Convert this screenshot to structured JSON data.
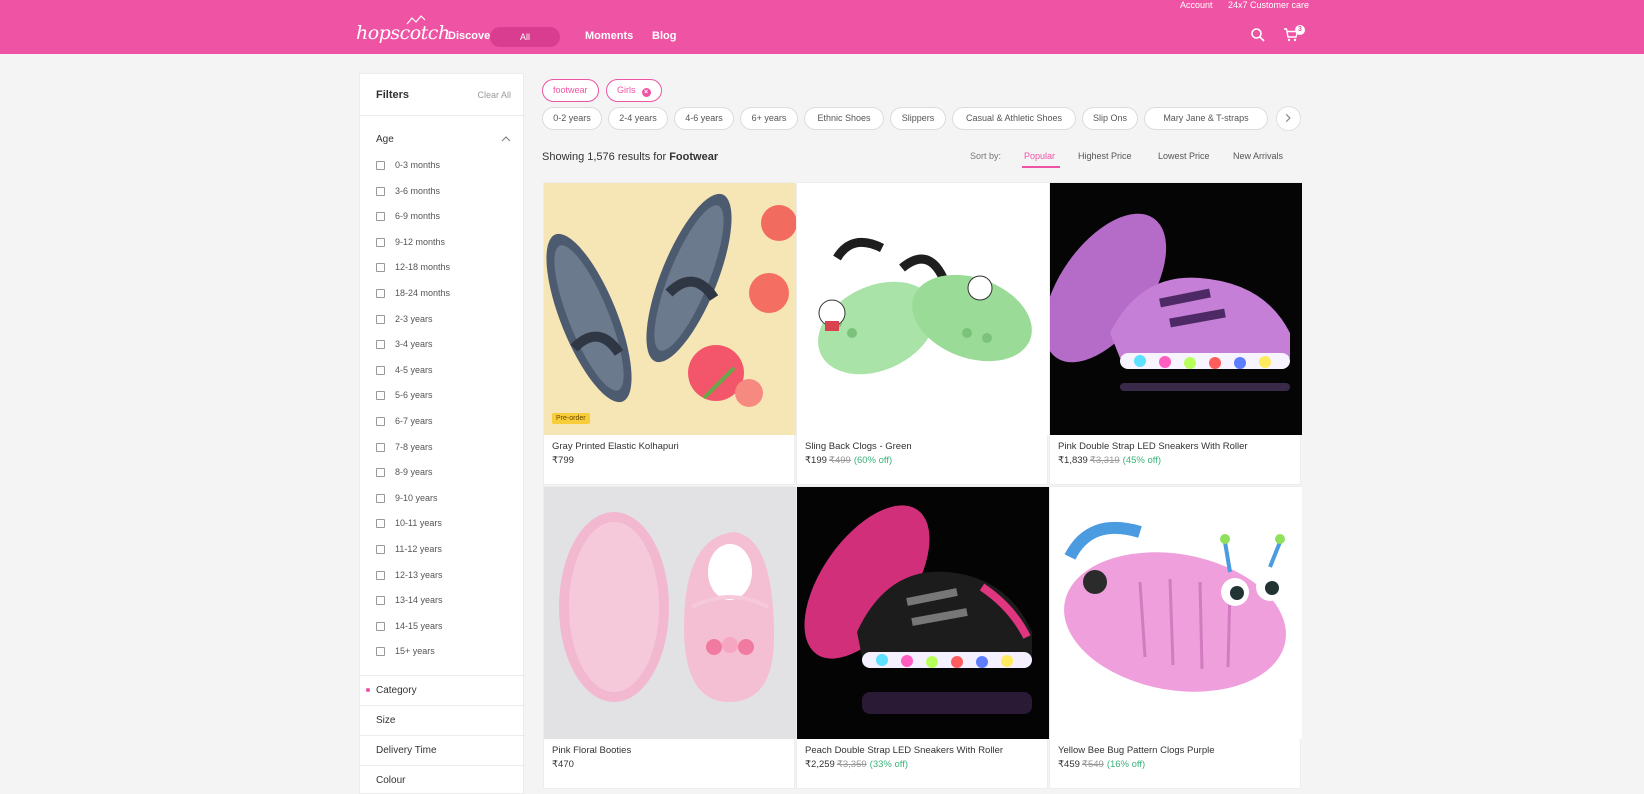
{
  "header": {
    "logo": "hopscotch",
    "utility": {
      "account": "Account",
      "support": "24x7 Customer care"
    },
    "nav": {
      "discover": "Discover",
      "all": "All",
      "moments": "Moments",
      "blog": "Blog"
    },
    "cart_count": "3",
    "colors": {
      "brand": "#ef53a4",
      "pill": "#d83d8f"
    }
  },
  "sidebar": {
    "title": "Filters",
    "clear_all": "Clear All",
    "age_label": "Age",
    "age_options": [
      "0-3 months",
      "3-6 months",
      "6-9 months",
      "9-12 months",
      "12-18 months",
      "18-24 months",
      "2-3 years",
      "3-4 years",
      "4-5 years",
      "5-6 years",
      "6-7 years",
      "7-8 years",
      "8-9 years",
      "9-10 years",
      "10-11 years",
      "11-12 years",
      "12-13 years",
      "13-14 years",
      "14-15 years",
      "15+ years"
    ],
    "sections": [
      "Category",
      "Size",
      "Delivery Time",
      "Colour"
    ]
  },
  "selected_chips": [
    "footwear",
    "Girls"
  ],
  "suggest_chips": [
    "0-2 years",
    "2-4 years",
    "4-6 years",
    "6+ years",
    "Ethnic Shoes",
    "Slippers",
    "Casual & Athletic Shoes",
    "Slip Ons",
    "Mary Jane & T-straps"
  ],
  "results": {
    "prefix": "Showing 1,576 results for",
    "term": "Footwear"
  },
  "sort": {
    "label": "Sort by:",
    "options": [
      "Popular",
      "Highest Price",
      "Lowest Price",
      "New Arrivals"
    ],
    "active": "Popular"
  },
  "products": [
    {
      "name": "Gray Printed Elastic Kolhapuri",
      "price": "₹799",
      "mrp": "",
      "discount": "",
      "badge": "Pre-order"
    },
    {
      "name": "Sling Back Clogs - Green",
      "price": "₹199",
      "mrp": "₹499",
      "discount": "(60% off)",
      "badge": ""
    },
    {
      "name": "Pink Double Strap LED Sneakers With Roller",
      "price": "₹1,839",
      "mrp": "₹3,319",
      "discount": "(45% off)",
      "badge": ""
    },
    {
      "name": "Pink Floral Booties",
      "price": "₹470",
      "mrp": "",
      "discount": "",
      "badge": ""
    },
    {
      "name": "Peach Double Strap LED Sneakers With Roller",
      "price": "₹2,259",
      "mrp": "₹3,359",
      "discount": "(33% off)",
      "badge": ""
    },
    {
      "name": "Yellow Bee Bug Pattern Clogs Purple",
      "price": "₹459",
      "mrp": "₹549",
      "discount": "(16% off)",
      "badge": ""
    }
  ],
  "icons": {
    "search": "search-icon",
    "cart": "cart-icon",
    "chevron_up": "chevron-up-icon",
    "chevron_right": "chevron-right-icon",
    "remove": "close-icon"
  }
}
